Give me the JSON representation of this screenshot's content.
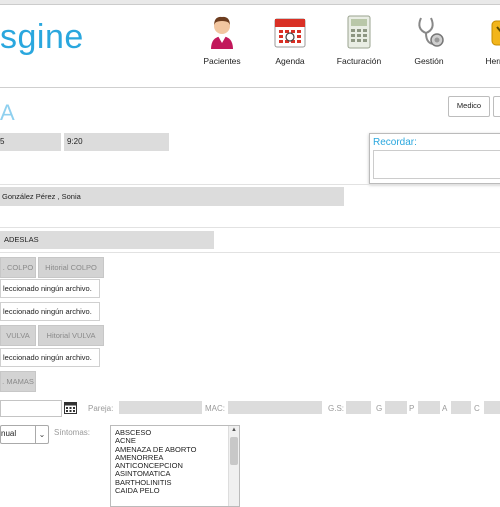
{
  "app": {
    "logo_text": "sgine"
  },
  "nav": [
    {
      "label": "Pacientes",
      "icon": "patient-icon"
    },
    {
      "label": "Agenda",
      "icon": "calendar-icon"
    },
    {
      "label": "Facturación",
      "icon": "calculator-icon"
    },
    {
      "label": "Gestión",
      "icon": "stethoscope-icon"
    },
    {
      "label": "Herra",
      "icon": "tools-icon"
    }
  ],
  "page": {
    "title_fragment": "A",
    "medico_button": "Medico"
  },
  "visit": {
    "date_fragment": "5",
    "time": "9:20"
  },
  "recordar": {
    "label": "Recordar:"
  },
  "patient": {
    "name": "González Pérez   , Sonia",
    "insurer": "ADESLAS"
  },
  "attachments": [
    {
      "button": ". COLPO",
      "history_button": "Hitorial COLPO",
      "file_text": "leccionado ningún archivo."
    },
    {
      "file_text": "leccionado ningún archivo."
    },
    {
      "button": "VULVA",
      "history_button": "Hitorial VULVA",
      "file_text": "leccionado ningún archivo."
    },
    {
      "button": ". MAMAS"
    }
  ],
  "form": {
    "pareja_label": "Pareja:",
    "mac_label": "MAC:",
    "gs_label": "G.S:",
    "g_label": "G",
    "p_label": "P",
    "a_label": "A",
    "c_label": "C",
    "select_value": "nual",
    "sintomas_label": "Síntomas:",
    "sintomas_options": [
      "ABSCESO",
      "ACNE",
      "AMENAZA DE ABORTO",
      "AMENORREA",
      "ANTICONCEPCION",
      "ASINTOMATICA",
      "BARTHOLINITIS",
      "CAIDA PELO"
    ]
  },
  "colors": {
    "brand": "#2aa7de",
    "field_grey": "#dcdcdc",
    "button_grey": "#d3d3d3"
  }
}
